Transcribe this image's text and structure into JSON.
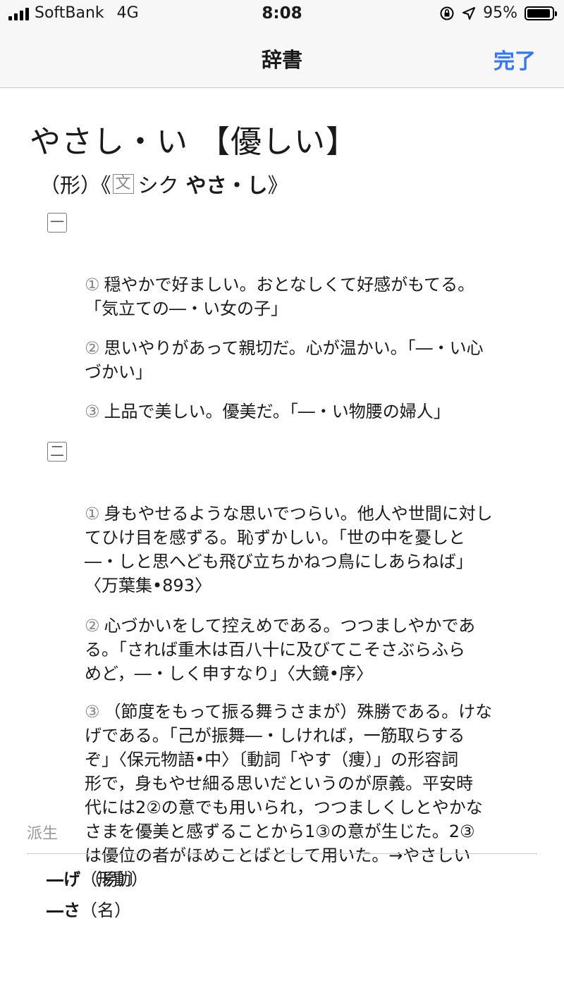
{
  "status": {
    "carrier": "SoftBank",
    "network": "4G",
    "time": "8:08",
    "battery_text": "95%",
    "battery_level": 0.95,
    "icons": [
      "signal-bars-icon",
      "orientation-lock-icon",
      "location-arrow-icon",
      "battery-icon"
    ]
  },
  "nav": {
    "title": "辞書",
    "done_label": "完了"
  },
  "entry": {
    "headword": "やさし・い 【優しい】",
    "pos_prefix": "（形）《",
    "pos_box": "文",
    "pos_conj": "シク",
    "pos_classical": "やさ・し",
    "pos_suffix": "》",
    "sections": [
      {
        "marker": "一",
        "definitions": [
          {
            "num": "①",
            "text": "穏やかで好ましい。おとなしくて好感がもてる。\n「気立ての―・い女の子」"
          },
          {
            "num": "②",
            "text": "思いやりがあって親切だ。心が温かい。「―・い心\nづかい」"
          },
          {
            "num": "③",
            "text": "上品で美しい。優美だ。「―・い物腰の婦人」"
          }
        ]
      },
      {
        "marker": "二",
        "definitions": [
          {
            "num": "①",
            "text": "身もやせるような思いでつらい。他人や世間に対し\nてひけ目を感ずる。恥ずかしい。「世の中を憂しと\n―・しと思へども飛び立ちかねつ鳥にしあらねば」\n〈万葉集•893〉"
          },
          {
            "num": "②",
            "text": "心づかいをして控えめである。つつましやかであ\nる。「されば重木は百八十に及びてこそさぶらふら\nめど，―・しく申すなり」〈大鏡•序〉"
          },
          {
            "num": "③",
            "text": "（節度をもって振る舞うさまが）殊勝である。けな\nげである。「己が振舞―・しければ，一筋取らする\nぞ」〈保元物語•中〉〔動詞「やす（痩）」の形容詞\n形で，身もやせ細る思いだというのが原義。平安時\n代には2②の意でも用いられ，つつましくしとやかな\nさまを優美と感ずることから1③の意が生じた。2③\nは優位の者がほめことばとして用いた。→やさしい\n（易）〕"
          }
        ]
      }
    ]
  },
  "derived": {
    "header": "派生",
    "items": [
      {
        "form": "―げ",
        "pos": "（形動）"
      },
      {
        "form": "―さ",
        "pos": "（名）"
      }
    ]
  }
}
